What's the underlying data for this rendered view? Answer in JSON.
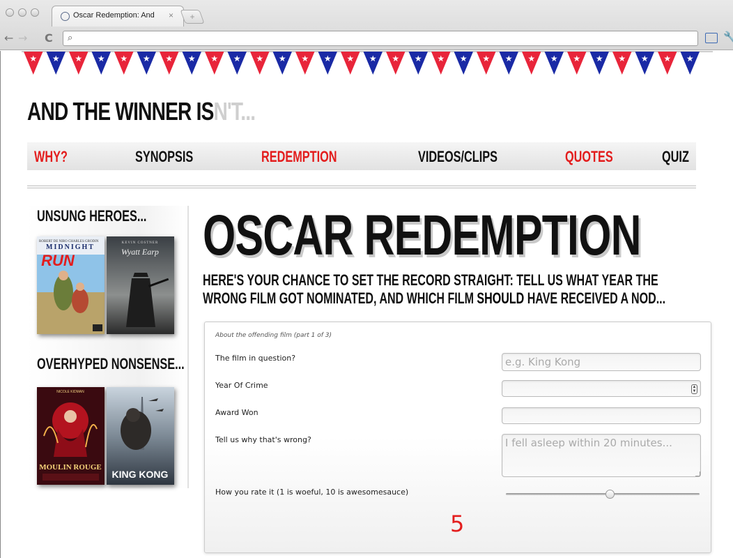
{
  "browser": {
    "tab_title": "Oscar Redemption: And the",
    "tab_close": "×",
    "back": "←",
    "forward": "→",
    "reload": "C",
    "address_value": ""
  },
  "site": {
    "title_dark": "AND THE WINNER IS",
    "title_light": "N'T..."
  },
  "nav": {
    "items": [
      {
        "label": "WHY?",
        "color": "#e31d1d"
      },
      {
        "label": "SYNOPSIS",
        "color": "#111111"
      },
      {
        "label": "REDEMPTION",
        "color": "#e31d1d"
      },
      {
        "label": "VIDEOS/CLIPS",
        "color": "#111111"
      },
      {
        "label": "QUOTES",
        "color": "#e31d1d"
      },
      {
        "label": "QUIZ",
        "color": "#111111"
      }
    ]
  },
  "sidebar": {
    "heading_unsung": "UNSUNG HEROES...",
    "heading_overhyped": "OVERHYPED NONSENSE...",
    "posters": [
      {
        "title": "MIDNIGHT",
        "subtitle": "RUN",
        "credits": "ROBERT DE NIRO   CHARLES GRODIN"
      },
      {
        "title": "Wyatt Earp",
        "credits": "KEVIN COSTNER"
      },
      {
        "title": "MOULIN ROUGE",
        "credits": "NICOLE KIDMAN"
      },
      {
        "title": "KING KONG",
        "credits": ""
      }
    ]
  },
  "main": {
    "title": "OSCAR REDEMPTION",
    "subtitle_before": "HERE'S YOUR CHANCE TO SET THE RECORD STRAIGHT: TELL US WHAT YEAR THE WRONG FILM GOT NOMINATED, AND WHICH FILM ",
    "subtitle_emph": "SHOULD",
    "subtitle_after": " HAVE RECEIVED A NOD..."
  },
  "form": {
    "caption": "About the offending film (part 1 of 3)",
    "film_label": "The film in question?",
    "film_placeholder": "e.g. King Kong",
    "year_label": "Year Of Crime",
    "award_label": "Award Won",
    "why_label": "Tell us why that's wrong?",
    "why_placeholder": "I fell asleep within 20 minutes...",
    "rating_label": "How you rate it (1 is woeful, 10 is awesomesauce)",
    "rating_value": "5",
    "rating_min": 1,
    "rating_max": 10
  },
  "colors": {
    "accent_red": "#e31d1d",
    "bunting_blue": "#1a2aa5",
    "bunting_red": "#e8253a"
  }
}
